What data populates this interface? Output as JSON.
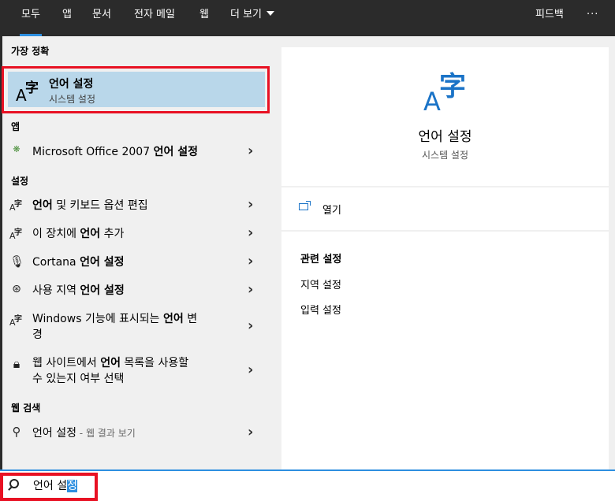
{
  "tabs": [
    {
      "label": "모두",
      "active": true
    },
    {
      "label": "앱"
    },
    {
      "label": "문서"
    },
    {
      "label": "전자 메일"
    },
    {
      "label": "웹"
    },
    {
      "label": "더 보기"
    }
  ],
  "header_right": {
    "feedback": "피드백",
    "more": "···"
  },
  "sections": {
    "best": "가장 정확",
    "apps": "앱",
    "settings": "설정",
    "web": "웹 검색"
  },
  "best_match": {
    "title": "언어 설정",
    "subtitle": "시스템 설정"
  },
  "apps": [
    {
      "pre": "Microsoft Office 2007 ",
      "bold": "언어 설정",
      "post": ""
    }
  ],
  "settings": [
    {
      "pre": "",
      "bold": "언어",
      "post": " 및 키보드 옵션 편집"
    },
    {
      "pre": "이 장치에 ",
      "bold": "언어",
      "post": " 추가"
    },
    {
      "pre": "Cortana ",
      "bold": "언어 설정",
      "post": ""
    },
    {
      "pre": "사용 지역 ",
      "bold": "언어 설정",
      "post": ""
    },
    {
      "pre": "Windows 기능에 표시되는 ",
      "bold": "언어",
      "post": " 변",
      "line2": "경"
    },
    {
      "pre": "웹 사이트에서 ",
      "bold": "언어",
      "post": " 목록을 사용할",
      "line2": "수 있는지 여부 선택"
    }
  ],
  "web_search": {
    "query": "언어 설정",
    "suffix": " - 웹 결과 보기"
  },
  "detail": {
    "title": "언어 설정",
    "subtitle": "시스템 설정",
    "open": "열기",
    "related_header": "관련 설정",
    "related": [
      "지역 설정",
      "입력 설정"
    ]
  },
  "search": {
    "text_plain": "언어 설",
    "text_selected": "정"
  },
  "icon_glyphs": {
    "A": "A",
    "zi": "字"
  },
  "colors": {
    "accent": "#2d8fe0",
    "highlight": "#e81123",
    "selection": "#b9d7ea",
    "topbar": "#2b2b2b"
  }
}
